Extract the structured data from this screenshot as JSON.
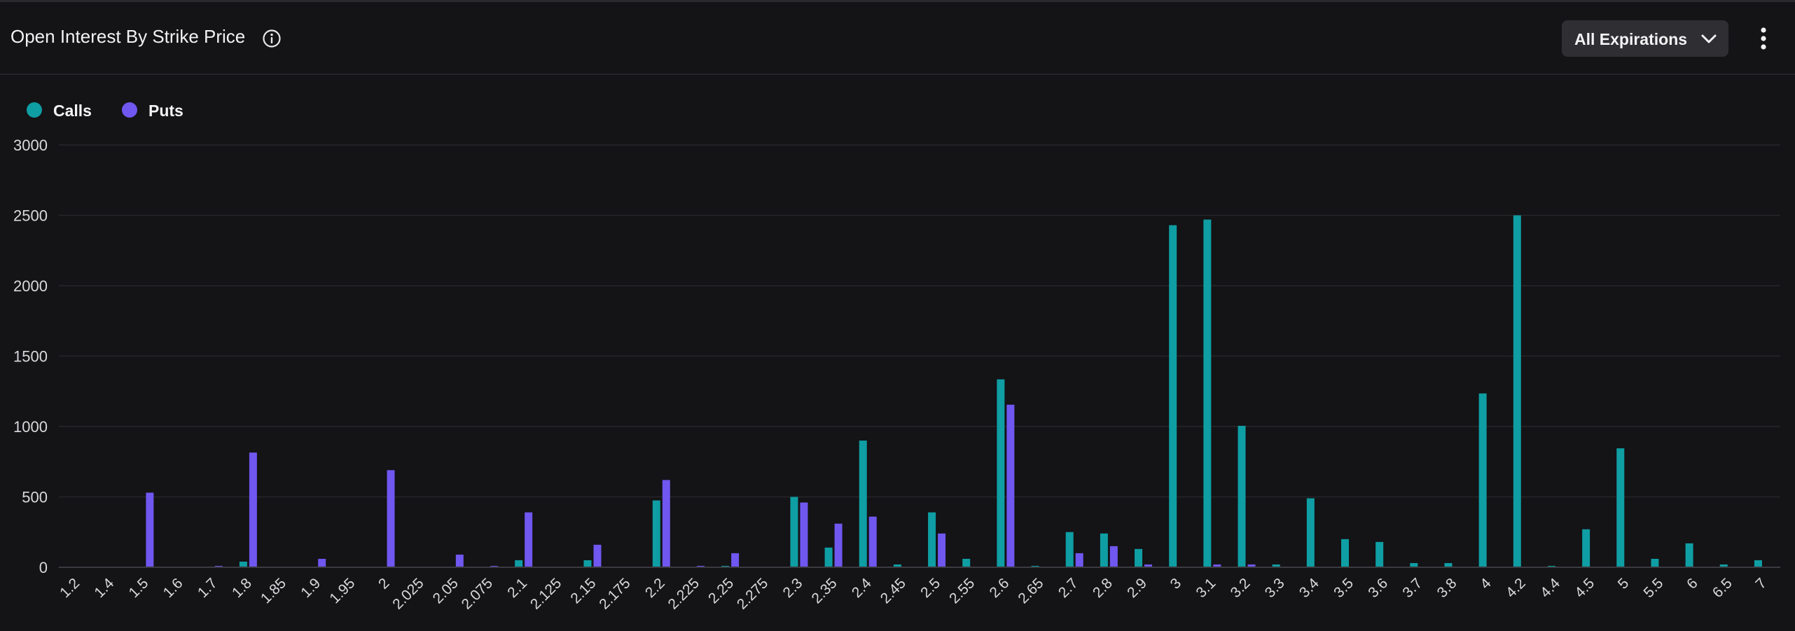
{
  "header": {
    "title": "Open Interest By Strike Price",
    "expirations_label": "All Expirations"
  },
  "icons": {
    "info": "info-icon",
    "chevron": "chevron-down-icon",
    "menu": "more-vertical-icon"
  },
  "colors": {
    "calls": "#0e9ea3",
    "puts": "#6f57ef",
    "background": "#141316",
    "grid": "#26262b"
  },
  "legend": [
    {
      "label": "Calls",
      "color": "#0e9ea3"
    },
    {
      "label": "Puts",
      "color": "#6f57ef"
    }
  ],
  "chart_data": {
    "type": "bar",
    "title": "Open Interest By Strike Price",
    "xlabel": "",
    "ylabel": "",
    "ylim": [
      0,
      3000
    ],
    "yticks": [
      0,
      500,
      1000,
      1500,
      2000,
      2500,
      3000
    ],
    "grid": true,
    "legend_position": "top-left",
    "categories": [
      "1.2",
      "1.4",
      "1.5",
      "1.6",
      "1.7",
      "1.8",
      "1.85",
      "1.9",
      "1.95",
      "2",
      "2.025",
      "2.05",
      "2.075",
      "2.1",
      "2.125",
      "2.15",
      "2.175",
      "2.2",
      "2.225",
      "2.25",
      "2.275",
      "2.3",
      "2.35",
      "2.4",
      "2.45",
      "2.5",
      "2.55",
      "2.6",
      "2.65",
      "2.7",
      "2.8",
      "2.9",
      "3",
      "3.1",
      "3.2",
      "3.3",
      "3.4",
      "3.5",
      "3.6",
      "3.7",
      "3.8",
      "4",
      "4.2",
      "4.4",
      "4.5",
      "5",
      "5.5",
      "6",
      "6.5",
      "7"
    ],
    "series": [
      {
        "name": "Calls",
        "color": "#0e9ea3",
        "values": [
          0,
          0,
          0,
          0,
          0,
          40,
          0,
          0,
          0,
          0,
          0,
          0,
          0,
          50,
          0,
          50,
          0,
          475,
          0,
          10,
          0,
          500,
          140,
          900,
          20,
          390,
          60,
          1335,
          10,
          250,
          240,
          130,
          2430,
          2470,
          1005,
          20,
          490,
          200,
          180,
          30,
          30,
          1235,
          2500,
          10,
          270,
          845,
          60,
          170,
          20,
          50
        ]
      },
      {
        "name": "Puts",
        "color": "#6f57ef",
        "values": [
          0,
          0,
          530,
          0,
          10,
          815,
          0,
          60,
          0,
          690,
          0,
          90,
          10,
          390,
          0,
          160,
          0,
          620,
          10,
          100,
          0,
          460,
          310,
          360,
          0,
          240,
          0,
          1155,
          0,
          100,
          150,
          20,
          0,
          20,
          20,
          0,
          0,
          0,
          0,
          0,
          0,
          0,
          0,
          0,
          0,
          0,
          0,
          0,
          0,
          0
        ]
      }
    ]
  }
}
